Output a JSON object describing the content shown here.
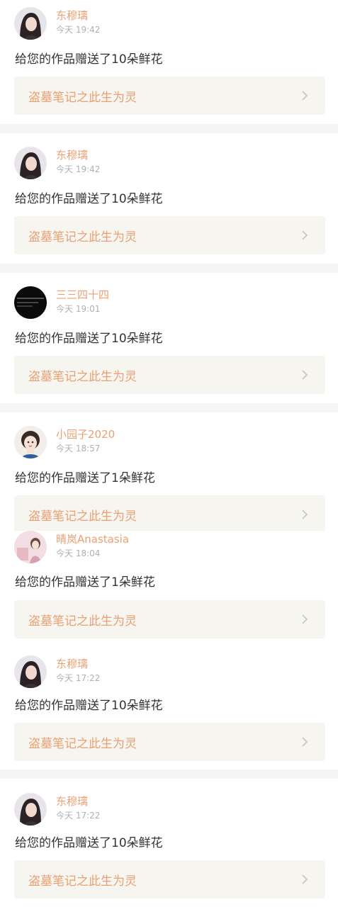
{
  "colors": {
    "accent": "#e8a074",
    "time": "#b0b0b0",
    "separator": "#f5f5f5",
    "work_bg": "#f6f5ef"
  },
  "notifications": [
    {
      "user": "东穆璃",
      "time": "今天 19:42",
      "message": "给您的作品赠送了10朵鲜花",
      "work": "盗墓笔记之此生为灵",
      "avatar": "woman-dark-hair-avatar"
    },
    {
      "user": "东穆璃",
      "time": "今天 19:42",
      "message": "给您的作品赠送了10朵鲜花",
      "work": "盗墓笔记之此生为灵",
      "avatar": "woman-dark-hair-avatar"
    },
    {
      "user": "三三四十四",
      "time": "今天 19:01",
      "message": "给您的作品赠送了10朵鲜花",
      "work": "盗墓笔记之此生为灵",
      "avatar": "dark-screenshot-avatar"
    },
    {
      "user": "小园子2020",
      "time": "今天 18:57",
      "message": "给您的作品赠送了1朵鲜花",
      "work": "盗墓笔记之此生为灵",
      "avatar": "cartoon-girl-avatar"
    },
    {
      "user": "晴岚Anastasia",
      "time": "今天 18:04",
      "message": "给您的作品赠送了1朵鲜花",
      "work": "盗墓笔记之此生为灵",
      "avatar": "pink-room-avatar"
    },
    {
      "user": "东穆璃",
      "time": "今天 17:22",
      "message": "给您的作品赠送了10朵鲜花",
      "work": "盗墓笔记之此生为灵",
      "avatar": "woman-dark-hair-avatar"
    },
    {
      "user": "东穆璃",
      "time": "今天 17:22",
      "message": "给您的作品赠送了10朵鲜花",
      "work": "盗墓笔记之此生为灵",
      "avatar": "woman-dark-hair-avatar"
    }
  ]
}
